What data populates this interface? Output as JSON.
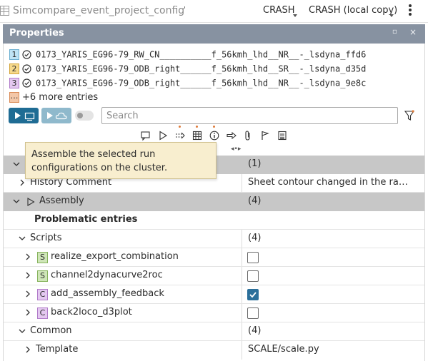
{
  "topbar": {
    "app_title": "Simcompare_event_project_config",
    "tick_mark": "'",
    "selector_1": "CRASH",
    "selector_2": "CRASH (local copy)",
    "icons": {
      "app": "table-icon",
      "menu": "kebab-menu-icon"
    }
  },
  "properties": {
    "title": "Properties",
    "header_buttons": {
      "restore": "▫",
      "close": "×"
    }
  },
  "entries": [
    {
      "index": "1",
      "name": "0173_YARIS_EG96-79_RW_CN__________f_56kmh_lhd__NR__-_lsdyna_ffd6",
      "badge_color": "#bfe3f5",
      "badge_border": "#6aaed0"
    },
    {
      "index": "2",
      "name": "0173_YARIS_EG96-79_ODB_right______f_56kmh_lhd__SR__-_lsdyna_d35d",
      "badge_color": "#f6d98b",
      "badge_border": "#d3a53a"
    },
    {
      "index": "3",
      "name": "0173_YARIS_EG96-79_ODB_right______f_56kmh_lhd__NR__-_lsdyna_9e8c",
      "badge_color": "#e4c8f0",
      "badge_border": "#b07ac9"
    }
  ],
  "more_entries": {
    "icon": "…",
    "label": "+6 more entries"
  },
  "toolbar": {
    "run_local_icon": "play-monitor-icon",
    "run_cluster_icon": "play-cloud-icon",
    "search_placeholder": "Search",
    "colors": {
      "run_local": "#1f6c94",
      "run_cluster": "#8fb9cc"
    }
  },
  "iconbar": [
    "comment-icon",
    "play-outline-icon",
    "export-icon",
    "table-icon",
    "info-icon",
    "arrow-right-icon",
    "paperclip-icon",
    "flag-icon",
    "report-icon"
  ],
  "tooltip": {
    "text": "Assemble the selected run configurations on the cluster."
  },
  "tree": {
    "section_top_count": "(1)",
    "history": {
      "label": "History Comment",
      "value": "Sheet contour changed in the radius"
    },
    "assembly": {
      "label": "Assembly",
      "count": "(4)"
    },
    "problematic": {
      "label": "Problematic entries"
    },
    "scripts": {
      "label": "Scripts",
      "count": "(4)"
    },
    "script_items": [
      {
        "type": "S",
        "name": "realize_export_combination",
        "checked": false
      },
      {
        "type": "S",
        "name": "channel2dynacurve2roc",
        "checked": false
      },
      {
        "type": "C",
        "name": "add_assembly_feedback",
        "checked": true
      },
      {
        "type": "C",
        "name": "back2loco_d3plot",
        "checked": false
      }
    ],
    "common": {
      "label": "Common",
      "count": "(4)"
    },
    "template": {
      "label": "Template",
      "value": "SCALE/scale.py"
    }
  }
}
